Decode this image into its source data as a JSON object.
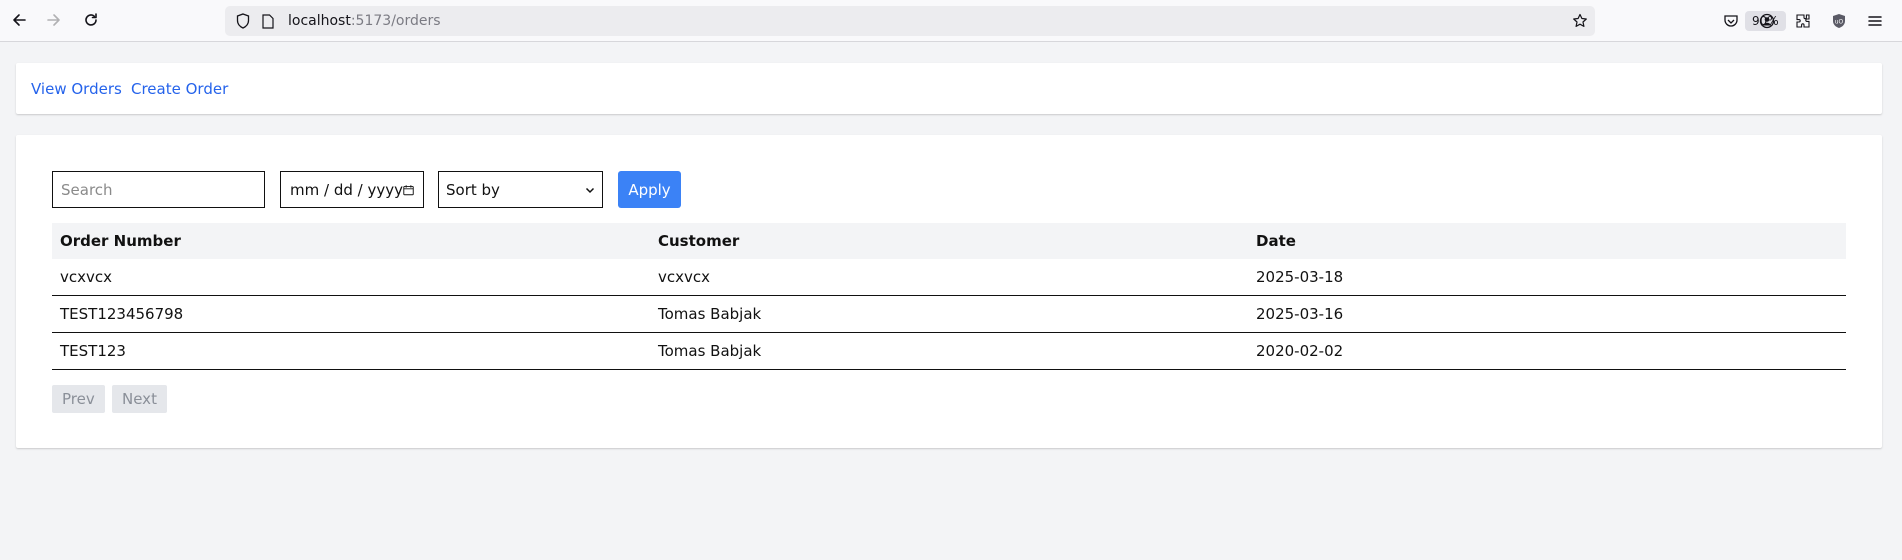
{
  "browser": {
    "url_host": "localhost",
    "url_path": ":5173/orders",
    "zoom": "90%"
  },
  "nav": {
    "view_orders": "View Orders",
    "create_order": "Create Order"
  },
  "filters": {
    "search_placeholder": "Search",
    "date_placeholder": "mm / dd / yyyy",
    "sort_label": "Sort by",
    "apply_label": "Apply"
  },
  "table": {
    "headers": [
      "Order Number",
      "Customer",
      "Date"
    ],
    "rows": [
      {
        "order_number": "vcxvcx",
        "customer": "vcxvcx",
        "date": "2025-03-18"
      },
      {
        "order_number": "TEST123456798",
        "customer": "Tomas Babjak",
        "date": "2025-03-16"
      },
      {
        "order_number": "TEST123",
        "customer": "Tomas Babjak",
        "date": "2020-02-02"
      }
    ]
  },
  "pagination": {
    "prev": "Prev",
    "next": "Next"
  },
  "colors": {
    "accent": "#3b82f6",
    "link": "#2563eb",
    "page_bg": "#f3f4f6"
  }
}
